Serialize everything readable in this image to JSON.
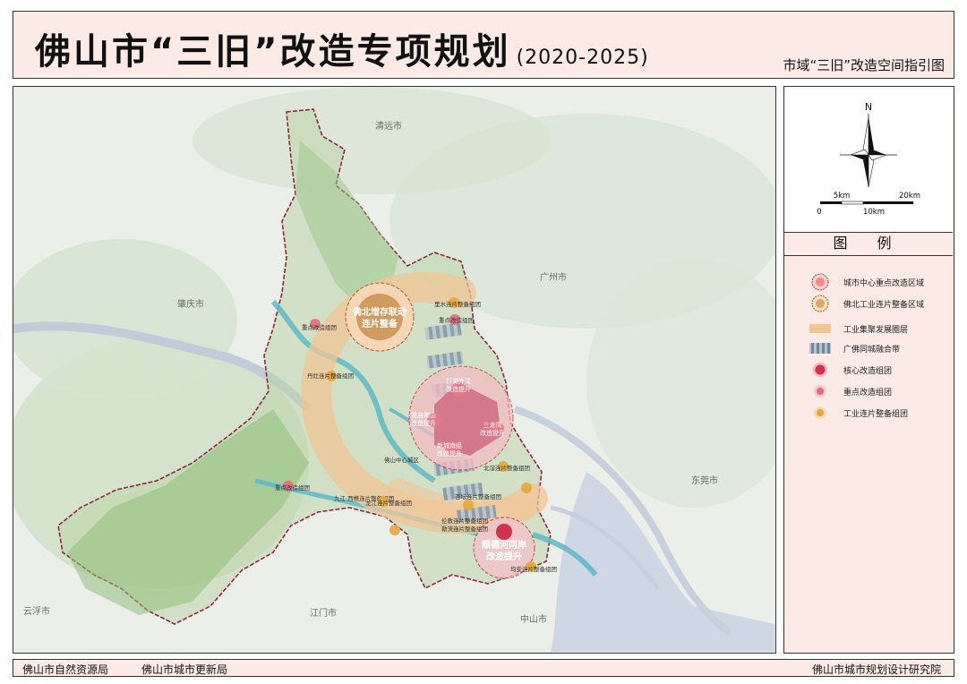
{
  "header": {
    "title": "佛山市“三旧”改造专项规划",
    "title_years": "(2020-2025)",
    "subtitle": "市域“三旧”改造空间指引图"
  },
  "compass": {
    "north_label": "N",
    "scale_5": "5km",
    "scale_20": "20km",
    "scale_0": "0",
    "scale_10": "10km"
  },
  "legend": {
    "title": "图 例",
    "items": [
      {
        "label": "城市中心重点改造区域",
        "icon": "city-center-zone-icon"
      },
      {
        "label": "佛北工业连片整备区域",
        "icon": "industrial-zone-icon"
      },
      {
        "label": "工业集聚发展圈层",
        "icon": "industry-ring-icon"
      },
      {
        "label": "广佛同城融合带",
        "icon": "guangfo-belt-icon"
      },
      {
        "label": "核心改造组团",
        "icon": "core-cluster-icon"
      },
      {
        "label": "重点改造组团",
        "icon": "key-cluster-icon"
      },
      {
        "label": "工业连片整备组团",
        "icon": "industrial-cluster-icon"
      }
    ]
  },
  "map": {
    "cities": {
      "qingyuan": "清远市",
      "zhaoqing": "肇庆市",
      "guangzhou": "广州市",
      "dongguan": "东莞市",
      "yunfu": "云浮市",
      "jiangmen": "江门市",
      "zhongshan": "中山市"
    },
    "zones": {
      "north_line1": "佛北增存联动",
      "north_line2": "连片整备",
      "south_line1": "顺德河两岸",
      "south_line2": "改造提升"
    },
    "core": {
      "top1": "灯湖外延",
      "top2": "改造提升",
      "left1": "祖庙佛山",
      "left2": "改造提升",
      "right1": "三龙湾",
      "right2": "改造提升",
      "bottom1": "新城南组",
      "bottom2": "改造提升"
    },
    "clusters": [
      "里水连片整备组团",
      "重点改造组团",
      "重点改造组团",
      "丹灶连片整备组团",
      "佛山中心城区",
      "北滘连片整备组团",
      "杏坛连片整备组团",
      "重点改造组团",
      "九江·西樵连片整备组团",
      "龙江连片整备组团",
      "伦教连片整备组团",
      "勒流连片整备组团",
      "均安连片整备组团"
    ]
  },
  "footer": {
    "left1": "佛山市自然资源局",
    "left2": "佛山市城市更新局",
    "right": "佛山市城市规划设计研究院"
  }
}
